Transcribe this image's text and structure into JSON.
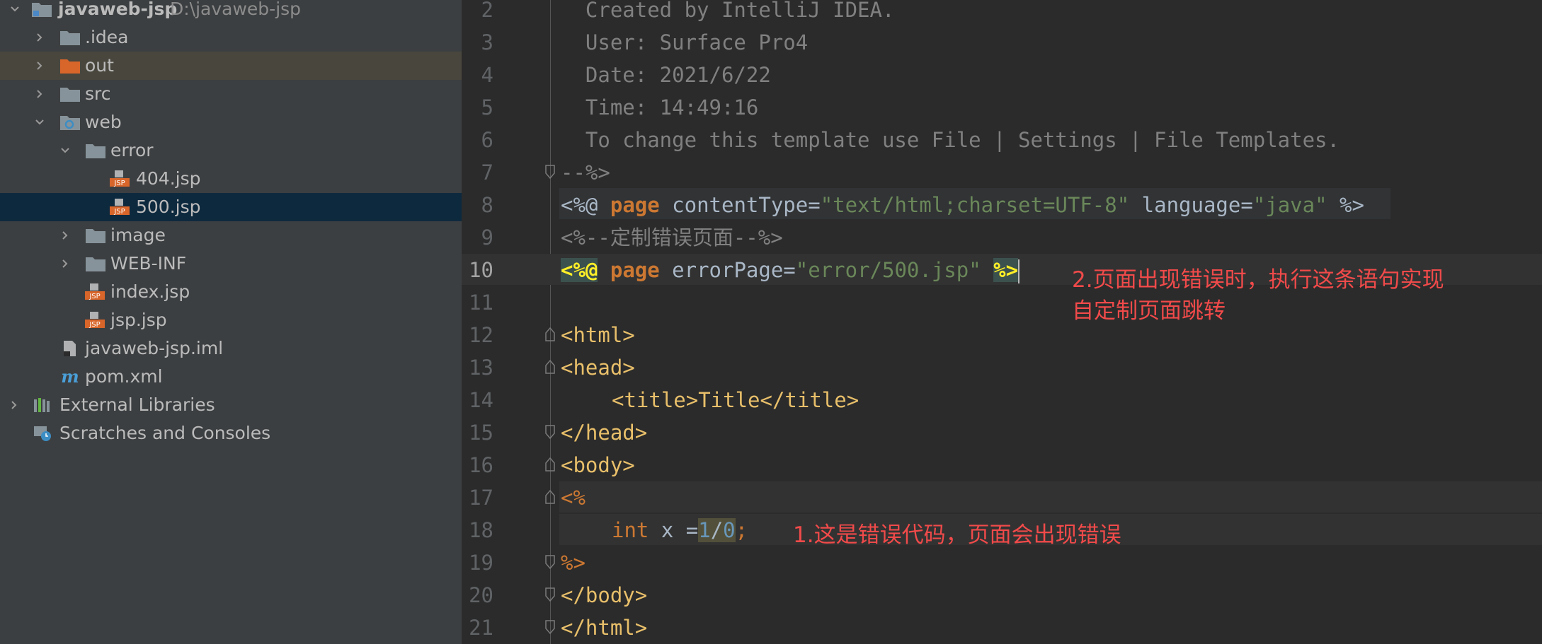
{
  "project_tree": {
    "root": {
      "name": "javaweb-jsp",
      "path": "D:\\javaweb-jsp"
    },
    "items": [
      {
        "label": ".idea"
      },
      {
        "label": "out"
      },
      {
        "label": "src"
      },
      {
        "label": "web"
      },
      {
        "label": "error"
      },
      {
        "label": "404.jsp"
      },
      {
        "label": "500.jsp"
      },
      {
        "label": "image"
      },
      {
        "label": "WEB-INF"
      },
      {
        "label": "index.jsp"
      },
      {
        "label": "jsp.jsp"
      },
      {
        "label": "javaweb-jsp.iml"
      },
      {
        "label": "pom.xml"
      },
      {
        "label": "External Libraries"
      },
      {
        "label": "Scratches and Consoles"
      }
    ],
    "jsp_badge": "JSP",
    "maven_badge": "m"
  },
  "editor": {
    "line_numbers": [
      "2",
      "3",
      "4",
      "5",
      "6",
      "7",
      "8",
      "9",
      "10",
      "11",
      "12",
      "13",
      "14",
      "15",
      "16",
      "17",
      "18",
      "19",
      "20",
      "21"
    ],
    "current_line": "10",
    "lines": {
      "l2": "  Created by IntelliJ IDEA.",
      "l3": "  User: Surface Pro4",
      "l4": "  Date: 2021/6/22",
      "l5": "  Time: 14:49:16",
      "l6": "  To change this template use File | Settings | File Templates.",
      "l7": "--%>",
      "l8": {
        "open": "<%@",
        "kw": "page",
        "attr1": " contentType=",
        "val1": "\"text/html;charset=UTF-8\"",
        "attr2": " language=",
        "val2": "\"java\"",
        "close": " %>"
      },
      "l9": "<%--定制错误页面--%>",
      "l10": {
        "open": "<%@",
        "kw": "page",
        "attr": " errorPage=",
        "val": "\"error/500.jsp\"",
        "close": "%>"
      },
      "l12": "<html>",
      "l13": "<head>",
      "l14": "<title>Title</title>",
      "l15": "</head>",
      "l16": "<body>",
      "l17": "<%",
      "l18": {
        "kw": "int",
        "rest": " x =",
        "n1": "1",
        "slash": "/",
        "n2": "0",
        "semi": ";"
      },
      "l19": "%>",
      "l20": "</body>",
      "l21": "</html>"
    },
    "annotations": {
      "note1": "1.这是错误代码，页面会出现错误",
      "note2_line1": "2.页面出现错误时，执行这条语句实现",
      "note2_line2": "自定制页面跳转"
    }
  },
  "colors": {
    "tree_bg": "#3c3f41",
    "editor_bg": "#2b2b2b",
    "selection": "#0d293e",
    "annotation_red": "#f14a4a",
    "jsp_badge_orange": "#d8652a",
    "keyword_orange": "#cc7832",
    "string_green": "#6a8759",
    "tag_yellow": "#e8bf6a"
  }
}
